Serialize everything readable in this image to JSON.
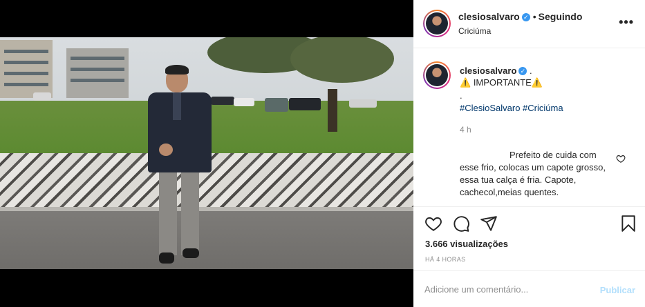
{
  "post": {
    "username": "clesiosalvaro",
    "follow_separator": "•",
    "follow_status": "Seguindo",
    "location": "Criciúma",
    "more_icon": "more-icon"
  },
  "caption": {
    "username": "clesiosalvaro",
    "trailing": ".",
    "warning_icon": "⚠️",
    "important": "IMPORTANTE",
    "dot_line": ".",
    "hashtags": "#ClesioSalvaro #Criciúma",
    "time": "4 h"
  },
  "reply": {
    "text": "Prefeito de cuida com esse frio, colocas um capote grosso, essa tua calça é fria. Capote, cachecol,meias quentes."
  },
  "actions": {
    "views": "3.666 visualizações",
    "ago": "HÁ 4 HORAS"
  },
  "composer": {
    "placeholder": "Adicione um comentário...",
    "publish": "Publicar"
  },
  "colors": {
    "verified": "#3897f0",
    "link": "#00376b",
    "publish_disabled": "#b2dffc"
  }
}
